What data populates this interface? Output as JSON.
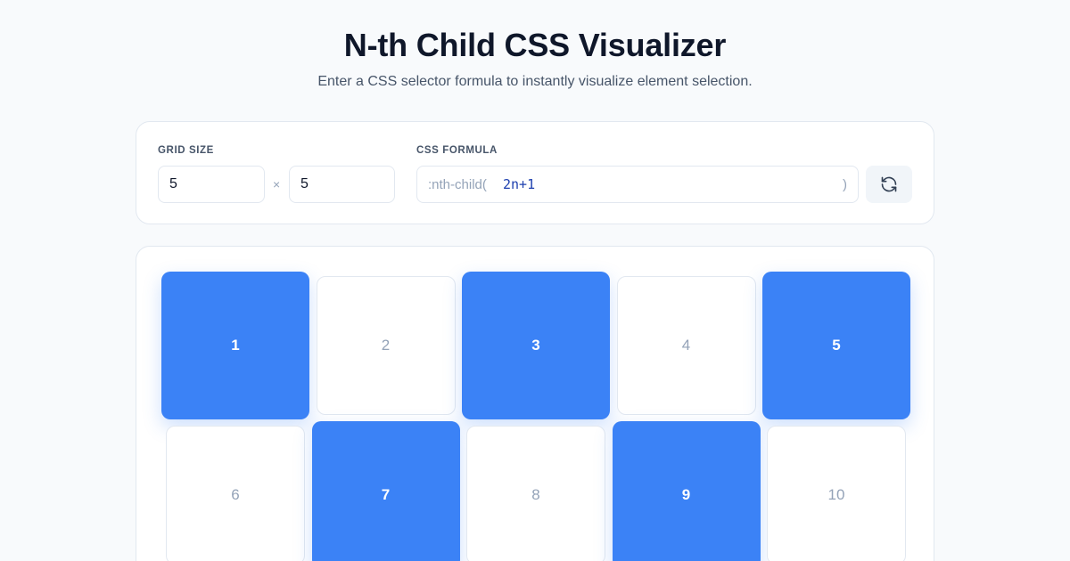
{
  "header": {
    "title": "N-th Child CSS Visualizer",
    "subtitle": "Enter a CSS selector formula to instantly visualize element selection."
  },
  "controls": {
    "grid_size_label": "GRID SIZE",
    "rows": "5",
    "times_symbol": "×",
    "cols": "5",
    "formula_label": "CSS FORMULA",
    "formula_prefix": ":nth-child(",
    "formula_value": "2n+1",
    "formula_suffix": ")",
    "refresh_icon": "refresh-icon"
  },
  "grid": {
    "cells": [
      {
        "label": "1",
        "selected": true
      },
      {
        "label": "2",
        "selected": false
      },
      {
        "label": "3",
        "selected": true
      },
      {
        "label": "4",
        "selected": false
      },
      {
        "label": "5",
        "selected": true
      },
      {
        "label": "6",
        "selected": false
      },
      {
        "label": "7",
        "selected": true
      },
      {
        "label": "8",
        "selected": false
      },
      {
        "label": "9",
        "selected": true
      },
      {
        "label": "10",
        "selected": false
      }
    ]
  },
  "colors": {
    "accent": "#3b82f6",
    "background": "#f8fafc",
    "card": "#ffffff",
    "muted_text": "#94a3b8"
  }
}
